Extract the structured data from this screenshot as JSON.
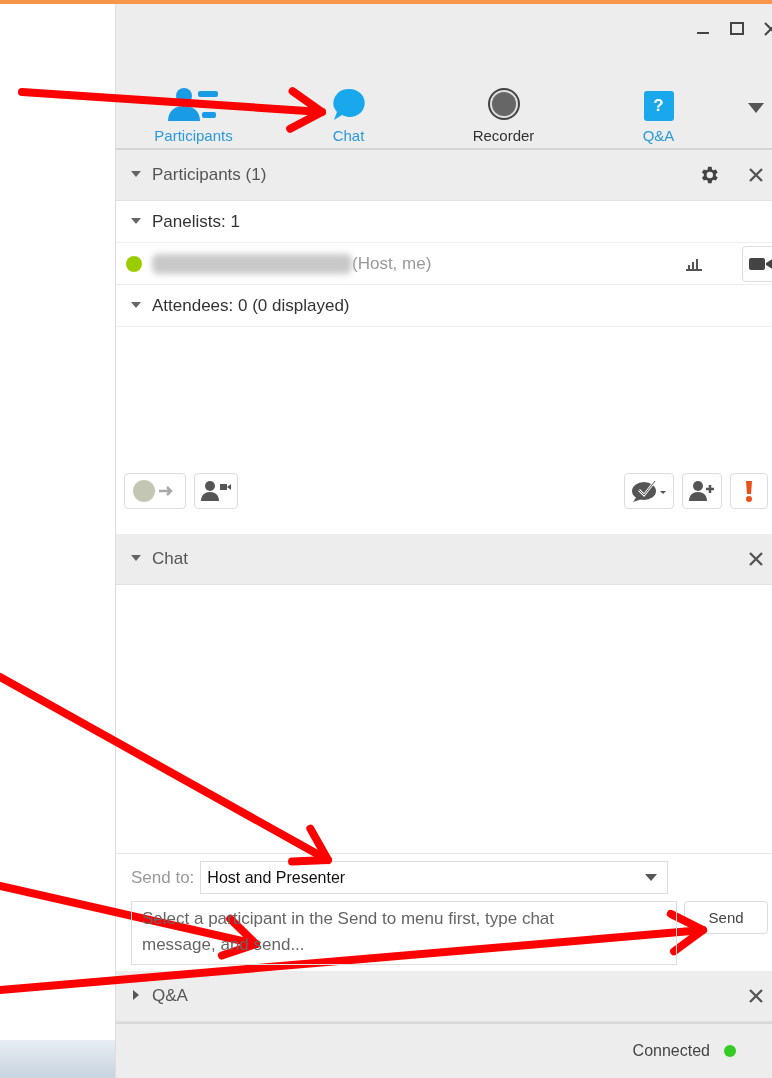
{
  "toolbar": {
    "tabs": [
      {
        "label": "Participants",
        "kind": "people",
        "active": true
      },
      {
        "label": "Chat",
        "kind": "chat",
        "active": true
      },
      {
        "label": "Recorder",
        "kind": "record",
        "active": false
      },
      {
        "label": "Q&A",
        "kind": "question",
        "icon_glyph": "?",
        "active": true
      }
    ]
  },
  "participants_panel": {
    "title": "Participants (1)",
    "expanded": true,
    "groups": [
      {
        "label": "Panelists: 1",
        "expanded": true,
        "members": [
          {
            "role": "(Host, me)"
          }
        ]
      },
      {
        "label": "Attendees: 0 (0 displayed)",
        "expanded": true
      }
    ]
  },
  "chat_panel": {
    "title": "Chat",
    "expanded": true,
    "send_to_label": "Send to:",
    "recipient": "Host and Presenter",
    "message_placeholder": "Select a participant in the Send to menu first, type chat message, and send...",
    "send_button": "Send"
  },
  "qa_panel": {
    "title": "Q&A",
    "expanded": false
  },
  "status_bar": {
    "text": "Connected"
  }
}
